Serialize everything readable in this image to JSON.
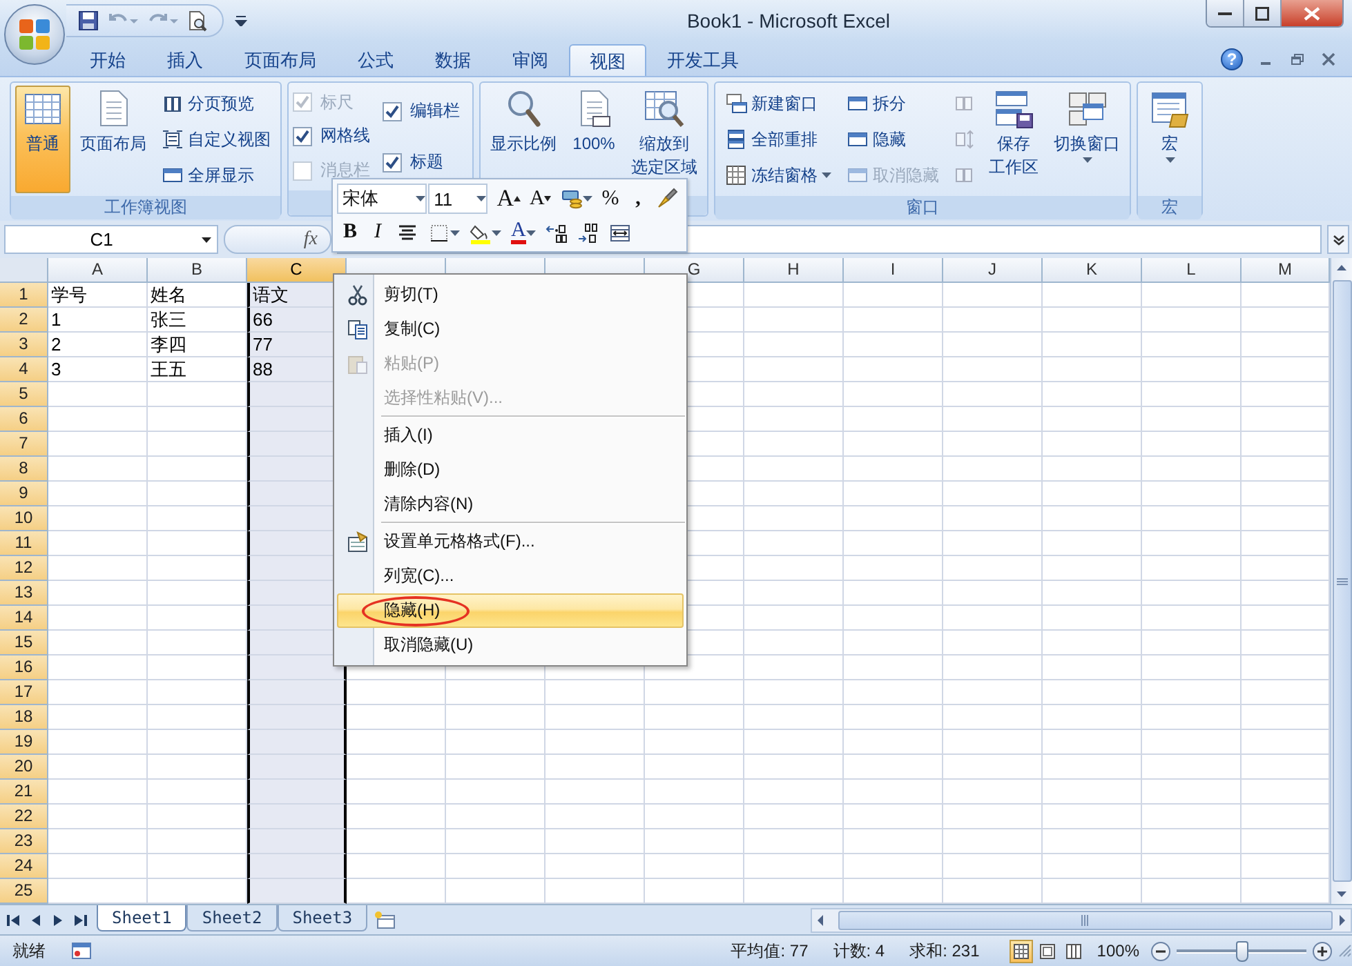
{
  "window": {
    "title": "Book1 - Microsoft Excel"
  },
  "tabs": [
    {
      "label": "开始",
      "selected": false
    },
    {
      "label": "插入",
      "selected": false
    },
    {
      "label": "页面布局",
      "selected": false
    },
    {
      "label": "公式",
      "selected": false
    },
    {
      "label": "数据",
      "selected": false
    },
    {
      "label": "审阅",
      "selected": false
    },
    {
      "label": "视图",
      "selected": true
    },
    {
      "label": "开发工具",
      "selected": false
    }
  ],
  "help_button": "?",
  "ribbon": {
    "groups": [
      {
        "label": "工作簿视图",
        "columns": [
          [
            {
              "kind": "large",
              "label": "普通",
              "selected": true
            }
          ],
          [
            {
              "kind": "large",
              "label": "页面布局",
              "selected": false
            }
          ],
          [
            {
              "kind": "small",
              "label": "分页预览"
            },
            {
              "kind": "small",
              "label": "自定义视图"
            },
            {
              "kind": "small",
              "label": "全屏显示"
            }
          ]
        ]
      },
      {
        "columns": [
          [
            {
              "kind": "checkbox",
              "label": "标尺",
              "checked": true,
              "disabled": true
            },
            {
              "kind": "checkbox",
              "label": "网格线",
              "checked": true,
              "disabled": false
            },
            {
              "kind": "checkbox",
              "label": "消息栏",
              "checked": false,
              "disabled": true
            }
          ],
          [
            {
              "kind": "checkbox",
              "label": "编辑栏",
              "checked": true,
              "disabled": false
            },
            {
              "kind": "checkbox",
              "label": "标题",
              "checked": true,
              "disabled": false
            }
          ]
        ]
      },
      {
        "columns": [
          [
            {
              "kind": "large",
              "label": "显示比例"
            }
          ],
          [
            {
              "kind": "large",
              "label": "100%"
            }
          ],
          [
            {
              "kind": "large",
              "lines": [
                "缩放到",
                "选定区域"
              ]
            }
          ]
        ]
      },
      {
        "label": "窗口",
        "columns": [
          [
            {
              "kind": "small",
              "label": "新建窗口",
              "disabled": false
            },
            {
              "kind": "small",
              "label": "全部重排",
              "disabled": false
            },
            {
              "kind": "small",
              "label": "冻结窗格",
              "dropdown": true,
              "disabled": false
            }
          ],
          [
            {
              "kind": "small",
              "label": "拆分",
              "disabled": false
            },
            {
              "kind": "small",
              "label": "隐藏",
              "disabled": false
            },
            {
              "kind": "small",
              "label": "取消隐藏",
              "disabled": true
            }
          ],
          [
            {
              "kind": "icon",
              "disabled": true
            },
            {
              "kind": "icon",
              "disabled": true
            },
            {
              "kind": "icon",
              "disabled": true
            }
          ],
          [
            {
              "kind": "large",
              "lines": [
                "保存",
                "工作区"
              ]
            }
          ],
          [
            {
              "kind": "large",
              "label": "切换窗口",
              "dropdown": true
            }
          ]
        ]
      },
      {
        "label": "宏",
        "columns": [
          [
            {
              "kind": "large",
              "label": "宏",
              "dropdown": true
            }
          ]
        ]
      }
    ]
  },
  "formula_bar": {
    "name_box": "C1",
    "function_button": "fx"
  },
  "grid": {
    "columns": [
      {
        "label": "A",
        "selected": false
      },
      {
        "label": "B",
        "selected": false
      },
      {
        "label": "C",
        "selected": true
      },
      {
        "selected": false
      },
      {
        "selected": false
      },
      {
        "selected": false
      },
      {
        "label": "G",
        "selected": false
      },
      {
        "label": "H",
        "selected": false
      },
      {
        "label": "I",
        "selected": false
      },
      {
        "label": "J",
        "selected": false
      },
      {
        "label": "K",
        "selected": false
      },
      {
        "label": "L",
        "selected": false
      },
      {
        "label": "M",
        "selected": false
      }
    ],
    "rows": [
      {
        "header": "1",
        "selected": true,
        "cells": [
          "学号",
          "姓名",
          "语文"
        ]
      },
      {
        "header": "2",
        "selected": true,
        "cells": [
          "1",
          "张三",
          "66"
        ]
      },
      {
        "header": "3",
        "selected": true,
        "cells": [
          "2",
          "李四",
          "77"
        ]
      },
      {
        "header": "4",
        "selected": true,
        "cells": [
          "3",
          "王五",
          "88"
        ]
      },
      {
        "header": "5",
        "selected": true
      },
      {
        "header": "6",
        "selected": true
      },
      {
        "header": "7",
        "selected": true
      },
      {
        "header": "8",
        "selected": true
      },
      {
        "header": "9",
        "selected": true
      },
      {
        "header": "10",
        "selected": true
      },
      {
        "header": "11",
        "selected": true
      },
      {
        "header": "12",
        "selected": true
      },
      {
        "header": "13",
        "selected": true
      },
      {
        "header": "14",
        "selected": true
      },
      {
        "header": "15",
        "selected": true
      },
      {
        "header": "16",
        "selected": true
      },
      {
        "header": "17",
        "selected": true
      },
      {
        "header": "18",
        "selected": true
      },
      {
        "header": "19",
        "selected": true
      },
      {
        "header": "20",
        "selected": true
      },
      {
        "header": "21",
        "selected": true
      },
      {
        "header": "22",
        "selected": true
      },
      {
        "header": "23",
        "selected": true
      },
      {
        "header": "24",
        "selected": true
      },
      {
        "header": "25",
        "selected": true
      }
    ]
  },
  "mini_toolbar": {
    "font": "宋体",
    "size": "11",
    "rows": [
      [
        {
          "kind": "grow",
          "text": "A"
        },
        {
          "kind": "shrink",
          "text": "A"
        },
        {
          "kind": "accounting",
          "dropdown": true
        },
        {
          "kind": "percent",
          "text": "%"
        },
        {
          "kind": "comma",
          "text": ","
        },
        {
          "kind": "painter"
        }
      ],
      [
        {
          "kind": "bold",
          "text": "B"
        },
        {
          "kind": "italic",
          "text": "I"
        },
        {
          "kind": "center"
        },
        {
          "kind": "borders",
          "dropdown": true
        },
        {
          "kind": "fill",
          "dropdown": true
        },
        {
          "kind": "fontcolor",
          "text": "A",
          "dropdown": true
        },
        {
          "kind": "increase"
        },
        {
          "kind": "decrease"
        },
        {
          "kind": "merge"
        }
      ]
    ]
  },
  "context_menu": {
    "items": [
      {
        "kind": "item",
        "label": "剪切(T)",
        "disabled": false,
        "selected": false
      },
      {
        "kind": "item",
        "label": "复制(C)",
        "disabled": false,
        "selected": false
      },
      {
        "kind": "item",
        "label": "粘贴(P)",
        "disabled": true,
        "selected": false
      },
      {
        "kind": "item",
        "label": "选择性粘贴(V)...",
        "disabled": true,
        "selected": false
      },
      {
        "kind": "separator"
      },
      {
        "kind": "item",
        "label": "插入(I)",
        "disabled": false,
        "selected": false
      },
      {
        "kind": "item",
        "label": "删除(D)",
        "disabled": false,
        "selected": false
      },
      {
        "kind": "item",
        "label": "清除内容(N)",
        "disabled": false,
        "selected": false
      },
      {
        "kind": "separator"
      },
      {
        "kind": "item",
        "label": "设置单元格格式(F)...",
        "disabled": false,
        "selected": false
      },
      {
        "kind": "item",
        "label": "列宽(C)...",
        "disabled": false,
        "selected": false
      },
      {
        "kind": "item",
        "label": "隐藏(H)",
        "disabled": false,
        "selected": true,
        "circled": true
      },
      {
        "kind": "item",
        "label": "取消隐藏(U)",
        "disabled": false,
        "selected": false
      }
    ]
  },
  "sheets": [
    {
      "label": "Sheet1",
      "selected": true
    },
    {
      "label": "Sheet2",
      "selected": false
    },
    {
      "label": "Sheet3",
      "selected": false
    }
  ],
  "status_bar": {
    "mode": "就绪",
    "stats": [
      "平均值: 77",
      "计数: 4",
      "求和: 231"
    ],
    "views": [
      {
        "selected": true
      },
      {
        "selected": false
      },
      {
        "selected": false
      }
    ],
    "zoom": "100%",
    "zoom_slider": {
      "level": 0.5
    }
  }
}
